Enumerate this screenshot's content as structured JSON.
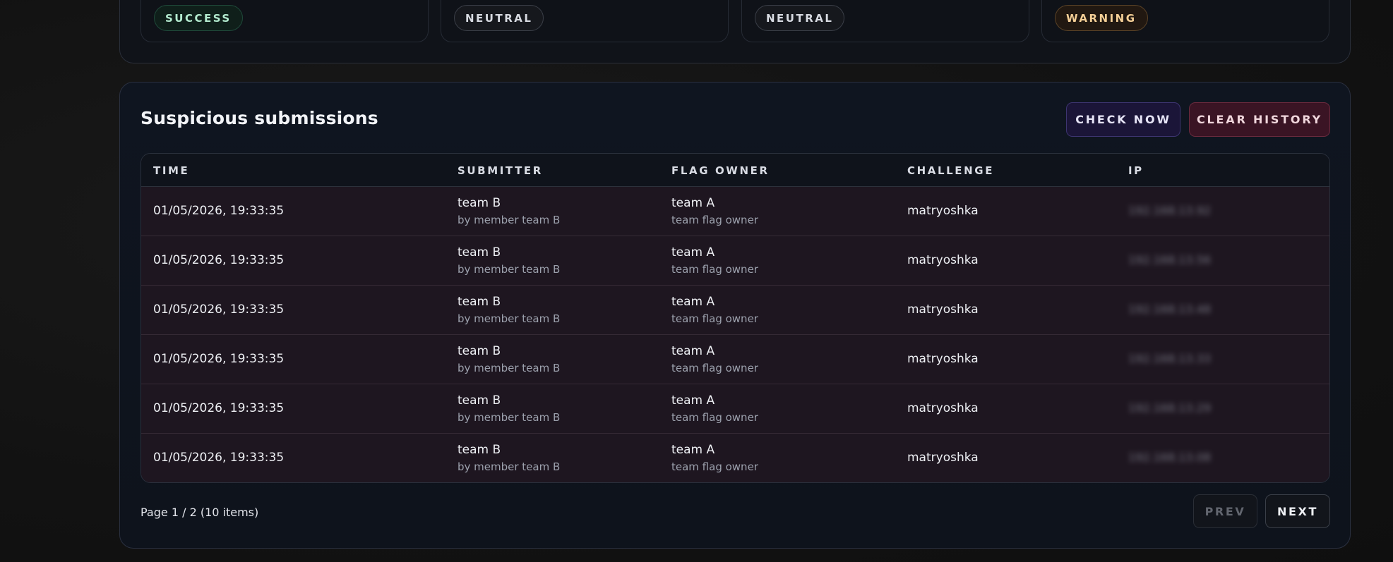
{
  "top_cards": [
    {
      "badge": "SUCCESS",
      "kind": "success"
    },
    {
      "badge": "NEUTRAL",
      "kind": "neutral"
    },
    {
      "badge": "NEUTRAL",
      "kind": "neutral"
    },
    {
      "badge": "WARNING",
      "kind": "warning"
    }
  ],
  "panel": {
    "title": "Suspicious submissions",
    "check_now_label": "CHECK NOW",
    "clear_history_label": "CLEAR HISTORY"
  },
  "table": {
    "headers": {
      "time": "TIME",
      "submitter": "SUBMITTER",
      "flag_owner": "FLAG OWNER",
      "challenge": "CHALLENGE",
      "ip": "IP"
    },
    "rows": [
      {
        "time": "01/05/2026, 19:33:35",
        "submitter": "team B",
        "submitter_sub": "by member team B",
        "owner": "team A",
        "owner_sub": "team flag owner",
        "challenge": "matryoshka",
        "ip": "192.168.13.92"
      },
      {
        "time": "01/05/2026, 19:33:35",
        "submitter": "team B",
        "submitter_sub": "by member team B",
        "owner": "team A",
        "owner_sub": "team flag owner",
        "challenge": "matryoshka",
        "ip": "192.168.13.56"
      },
      {
        "time": "01/05/2026, 19:33:35",
        "submitter": "team B",
        "submitter_sub": "by member team B",
        "owner": "team A",
        "owner_sub": "team flag owner",
        "challenge": "matryoshka",
        "ip": "192.168.13.48"
      },
      {
        "time": "01/05/2026, 19:33:35",
        "submitter": "team B",
        "submitter_sub": "by member team B",
        "owner": "team A",
        "owner_sub": "team flag owner",
        "challenge": "matryoshka",
        "ip": "192.168.13.33"
      },
      {
        "time": "01/05/2026, 19:33:35",
        "submitter": "team B",
        "submitter_sub": "by member team B",
        "owner": "team A",
        "owner_sub": "team flag owner",
        "challenge": "matryoshka",
        "ip": "192.168.13.29"
      },
      {
        "time": "01/05/2026, 19:33:35",
        "submitter": "team B",
        "submitter_sub": "by member team B",
        "owner": "team A",
        "owner_sub": "team flag owner",
        "challenge": "matryoshka",
        "ip": "192.168.13.08"
      }
    ]
  },
  "pagination": {
    "info": "Page 1 / 2 (10 items)",
    "prev_label": "PREV",
    "next_label": "NEXT"
  }
}
